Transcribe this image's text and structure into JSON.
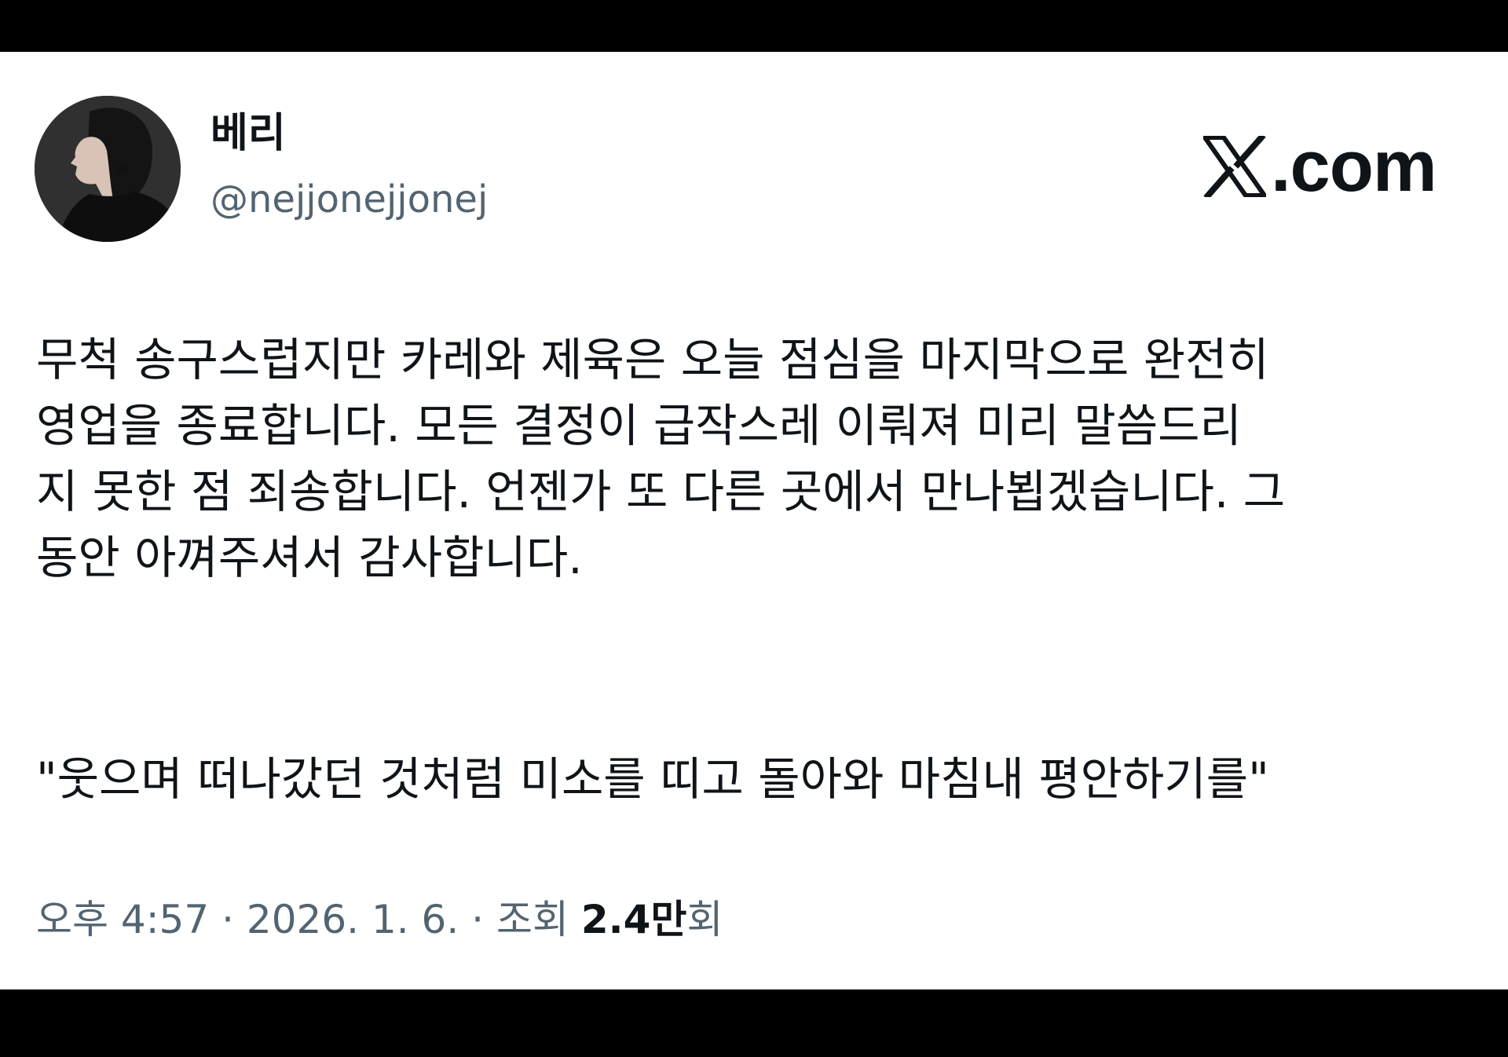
{
  "profile": {
    "avatar": "avatar-photo",
    "display_name": "베리",
    "handle": "@nejjonejjonej"
  },
  "brand": {
    "icon": "x-logo-icon",
    "domain_text": ".com"
  },
  "post": {
    "body_lines": [
      "무척 송구스럽지만 카레와 제육은 오늘 점심을 마지막으로 완전히",
      "영업을 종료합니다. 모든 결정이 급작스레 이뤄져 미리 말씀드리",
      "지 못한 점 죄송합니다. 언젠가 또 다른 곳에서 만나뵙겠습니다. 그",
      "동안 아껴주셔서 감사합니다."
    ],
    "quote": "\"웃으며 떠나갔던 것처럼 미소를 띠고 돌아와 마침내 평안하기를\""
  },
  "meta": {
    "time": "오후 4:57",
    "separator": "·",
    "date": "2026. 1. 6.",
    "views_label": "조회",
    "views_count": "2.4만",
    "views_suffix": "회"
  },
  "colors": {
    "frame": "#000000",
    "background": "#ffffff",
    "text_primary": "#0f1419",
    "text_secondary": "#536471"
  }
}
